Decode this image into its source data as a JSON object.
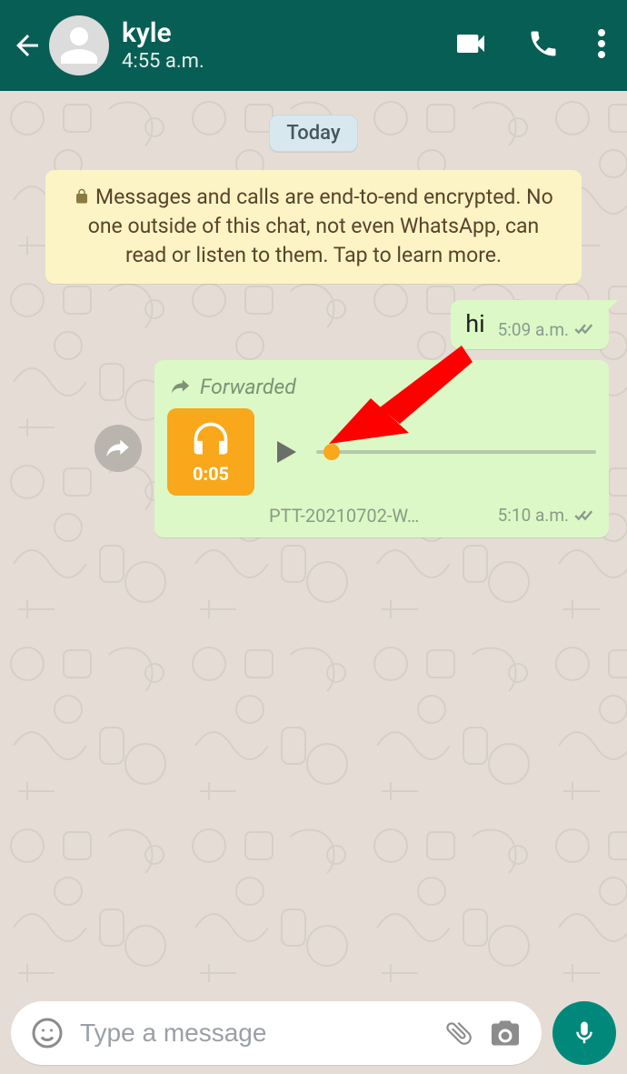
{
  "header": {
    "contact_name": "kyle",
    "last_seen": "4:55 a.m."
  },
  "chat": {
    "date_pill": "Today",
    "encryption_banner": "Messages and calls are end-to-end encrypted. No one outside of this chat, not even WhatsApp, can read or listen to them. Tap to learn more."
  },
  "messages": {
    "text1": {
      "text": "hi",
      "time": "5:09 a.m."
    },
    "audio1": {
      "forwarded_label": "Forwarded",
      "duration": "0:05",
      "filename": "PTT-20210702-W…",
      "time": "5:10 a.m."
    }
  },
  "input": {
    "placeholder": "Type a message"
  }
}
